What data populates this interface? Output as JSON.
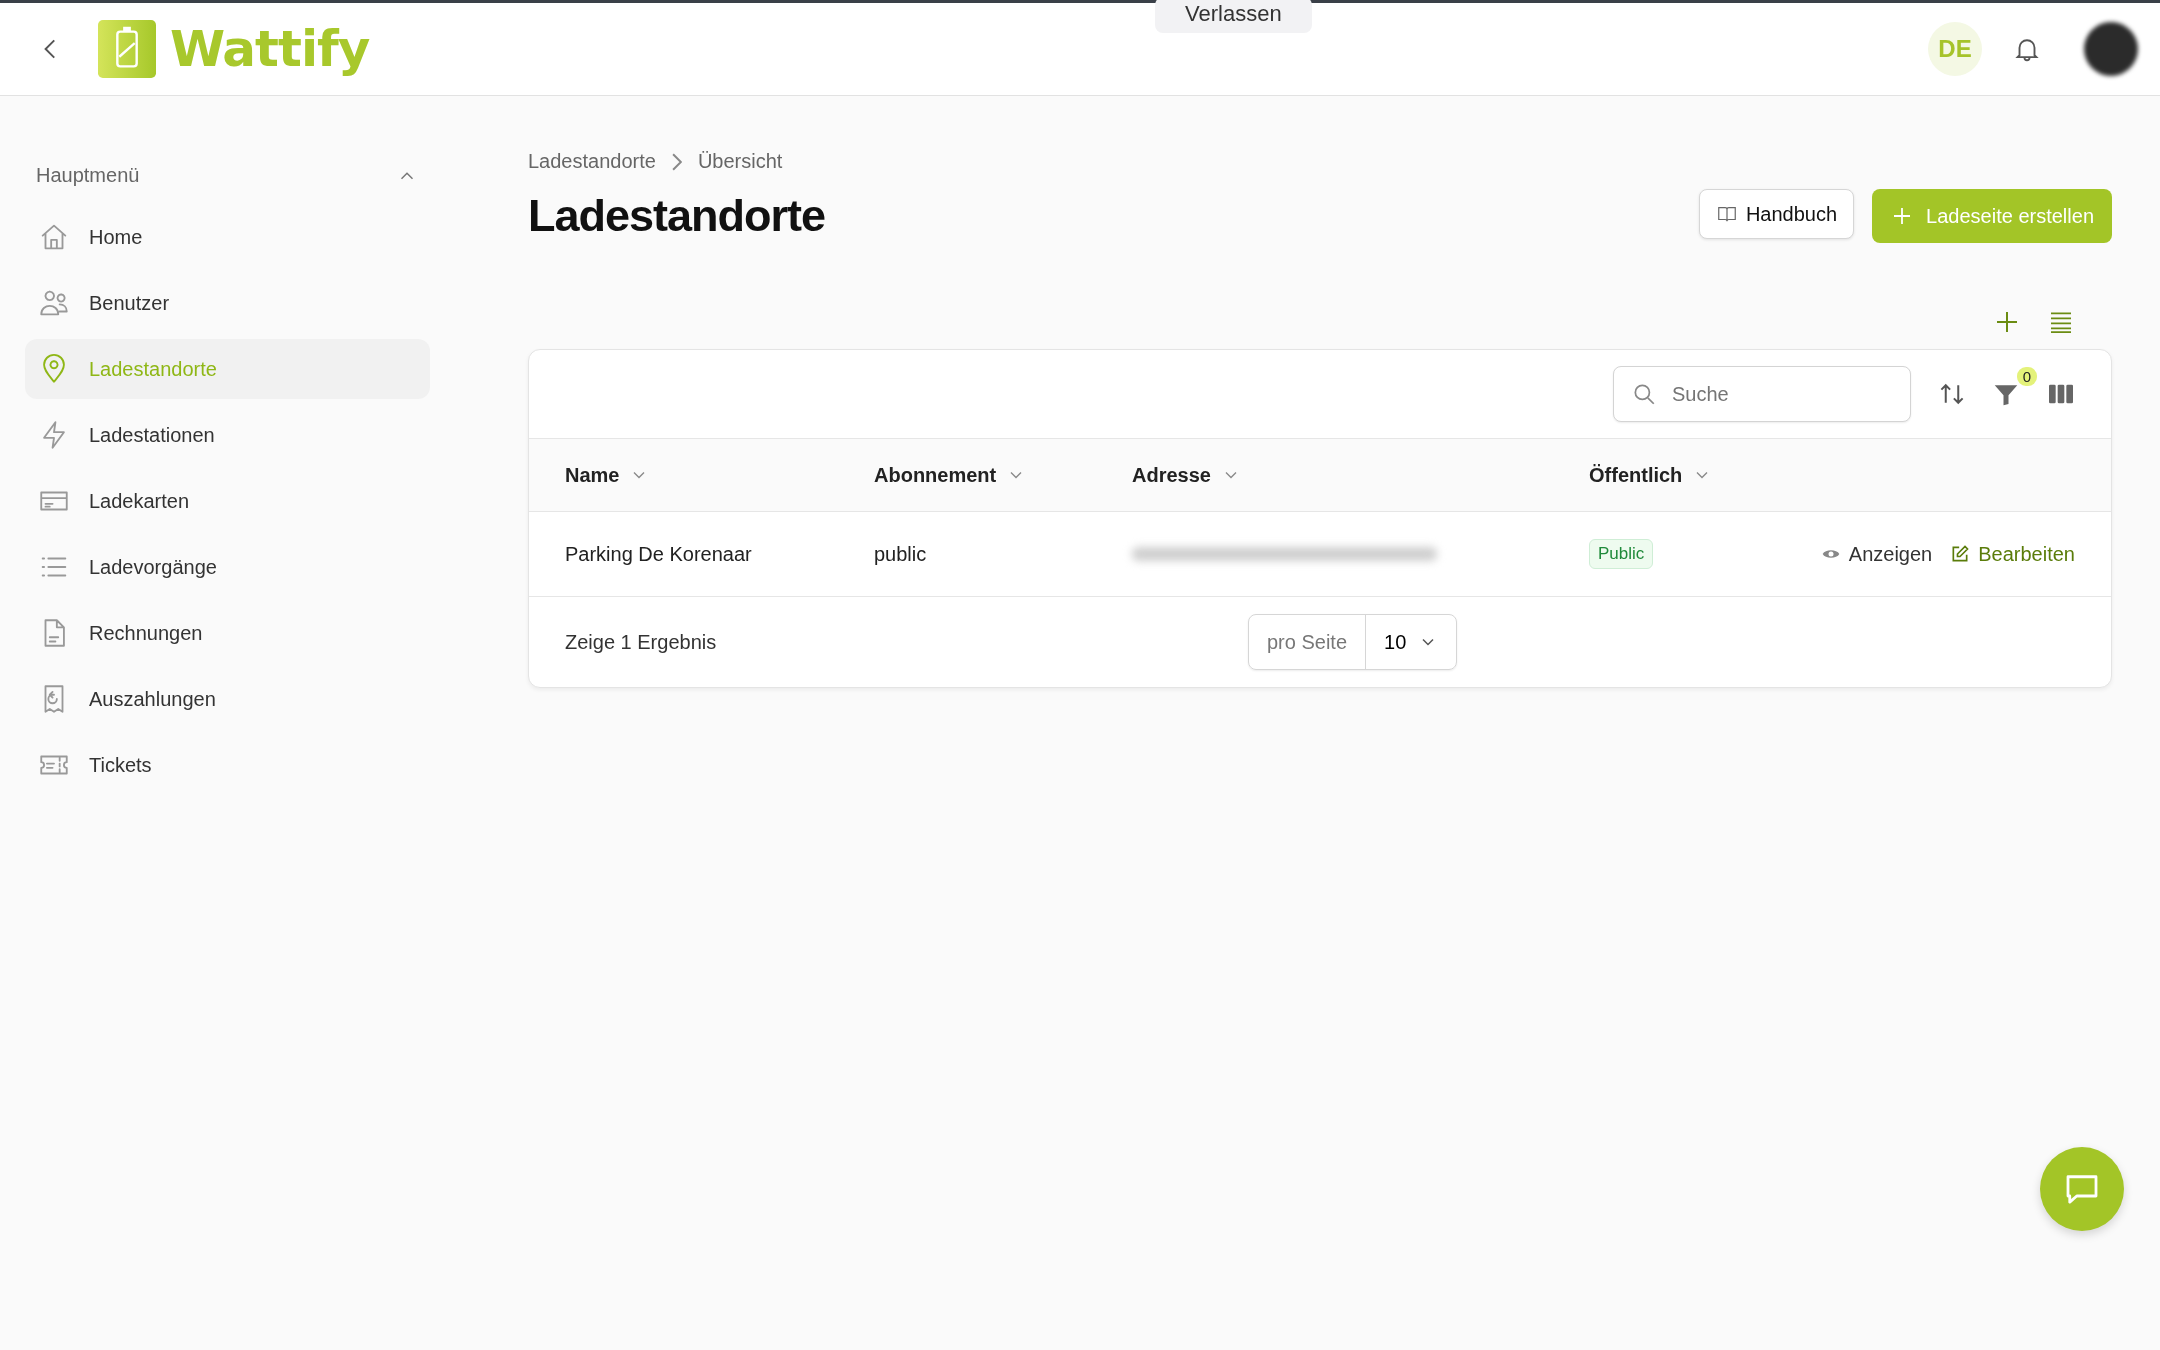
{
  "top_overlay": {
    "button": "Verlassen"
  },
  "header": {
    "logo": "Wattify",
    "language": "DE"
  },
  "sidebar": {
    "section": "Hauptmenü",
    "expanded": true,
    "items": [
      {
        "label": "Home",
        "selected": false
      },
      {
        "label": "Benutzer",
        "selected": false
      },
      {
        "label": "Ladestandorte",
        "selected": true
      },
      {
        "label": "Ladestationen",
        "selected": false
      },
      {
        "label": "Ladekarten",
        "selected": false
      },
      {
        "label": "Ladevorgänge",
        "selected": false
      },
      {
        "label": "Rechnungen",
        "selected": false
      },
      {
        "label": "Auszahlungen",
        "selected": false
      },
      {
        "label": "Tickets",
        "selected": false
      }
    ]
  },
  "breadcrumb": [
    "Ladestandorte",
    "Übersicht"
  ],
  "page_title": "Ladestandorte",
  "buttons": {
    "manual": "Handbuch",
    "create": "Ladeseite erstellen"
  },
  "table": {
    "search": {
      "placeholder": "Suche"
    },
    "filter_count": "0",
    "columns": [
      "Name",
      "Abonnement",
      "Adresse",
      "Öffentlich"
    ],
    "rows": [
      {
        "name": "Parking De Korenaar",
        "subscription": "public",
        "public": "Public",
        "actions": [
          "Anzeigen",
          "Bearbeiten"
        ]
      }
    ],
    "footer": {
      "summary": "Zeige 1 Ergebnis",
      "per_page_label": "pro Seite",
      "per_page": "10"
    }
  }
}
